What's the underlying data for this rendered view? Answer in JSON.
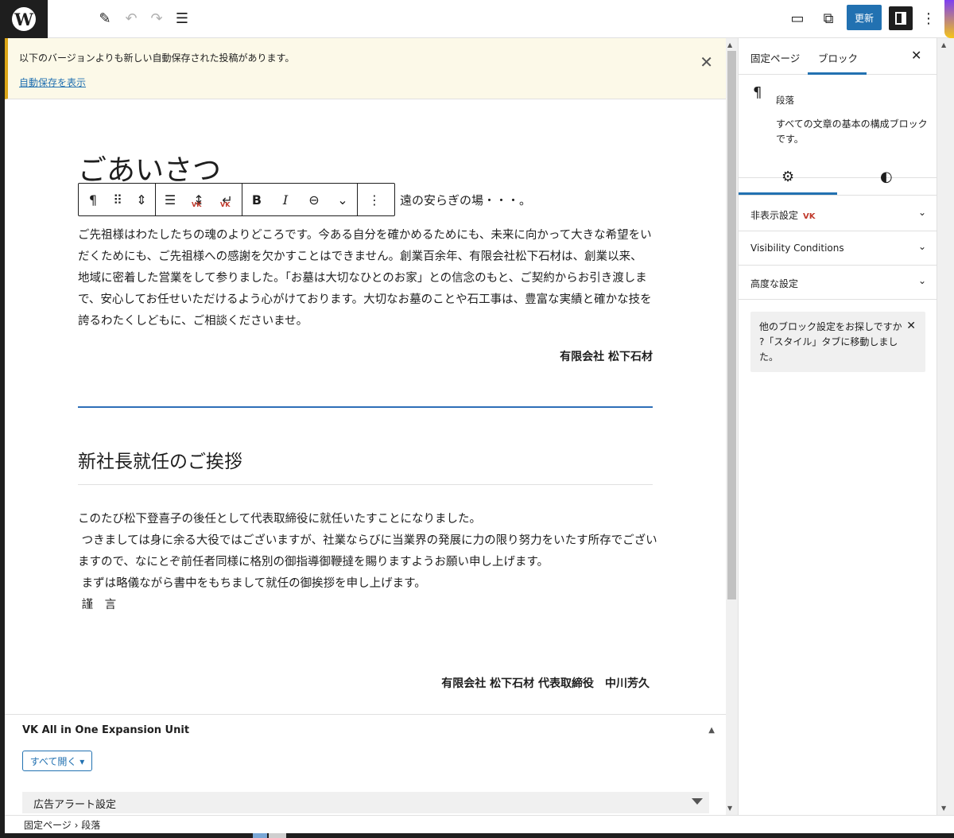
{
  "topbar": {
    "update_label": "更新",
    "add_icon_glyph": "+",
    "edit_icon_glyph": "✎",
    "undo_icon_glyph": "↶",
    "redo_icon_glyph": "↷",
    "outline_icon_glyph": "☰",
    "preview_icon_glyph": "▭",
    "view_icon_glyph": "⧉",
    "options_icon_glyph": "⋮",
    "logo_glyph": "W"
  },
  "notice": {
    "message": "以下のバージョンよりも新しい自動保存された投稿があります。",
    "link": "自動保存を表示",
    "close_glyph": "✕"
  },
  "block_toolbar": {
    "pilcrow": "¶",
    "drag": "⠿",
    "move": "⇕",
    "align": "☰",
    "height": "↨",
    "newline": "↵",
    "vk_mark": "VK",
    "bold": "B",
    "italic": "I",
    "link": "⊖",
    "more": "⌄",
    "options": "⋮"
  },
  "content": {
    "heading1": "ごあいさつ",
    "partial_line": "遠の安らぎの場・・・。",
    "paragraph1": "ご先祖様はわたしたちの魂のよりどころです。今ある自分を確かめるためにも、未来に向かって大きな希望をいだくためにも、ご先祖様への感謝を欠かすことはできません。創業百余年、有限会社松下石材は、創業以来、地域に密着した営業をして参りました。「お墓は大切なひとのお家」との信念のもと、ご契約からお引き渡しまで、安心してお任せいただけるよう心がけております。大切なお墓のことや石工事は、豊富な実績と確かな技を誇るわたくしどもに、ご相談くださいませ。",
    "signature1": "有限会社 松下石材",
    "heading2": "新社長就任のご挨拶",
    "paragraph2": "このたび松下登喜子の後任として代表取締役に就任いたすことになりました。\n つきましては身に余る大役ではございますが、社業ならびに当業界の発展に力の限り努力をいたす所存でございますので、なにとぞ前任者同様に格別の御指導御鞭撻を賜りますようお願い申し上げます。\n まずは略儀ながら書中をもちまして就任の御挨拶を申し上げます。\n 謹　言",
    "signature2": "有限会社 松下石材  代表取締役　中川芳久"
  },
  "metabox": {
    "title": "VK All in One Expansion Unit",
    "caret": "▲",
    "open_all_label": "すべて開く ▾",
    "ad_alert_label": "広告アラート設定"
  },
  "footer": {
    "breadcrumb": "固定ページ  ›  段落"
  },
  "sidebar": {
    "tab_page": "固定ページ",
    "tab_block": "ブロック",
    "close_glyph": "✕",
    "block_icon": "¶",
    "block_name": "段落",
    "block_description": "すべての文章の基本の構成ブロックです。",
    "gear_glyph": "⚙",
    "contrast_glyph": "◐",
    "panels": [
      {
        "label": "非表示設定",
        "vk": "VK"
      },
      {
        "label": "Visibility Conditions",
        "vk": ""
      },
      {
        "label": "高度な設定",
        "vk": ""
      }
    ],
    "chevron_glyph": "⌄",
    "tip_text": "他のブロック設定をお探しですか ?「スタイル」タブに移動しました。",
    "tip_close_glyph": "✕"
  },
  "scroll": {
    "up_glyph": "▲",
    "down_glyph": "▼"
  }
}
